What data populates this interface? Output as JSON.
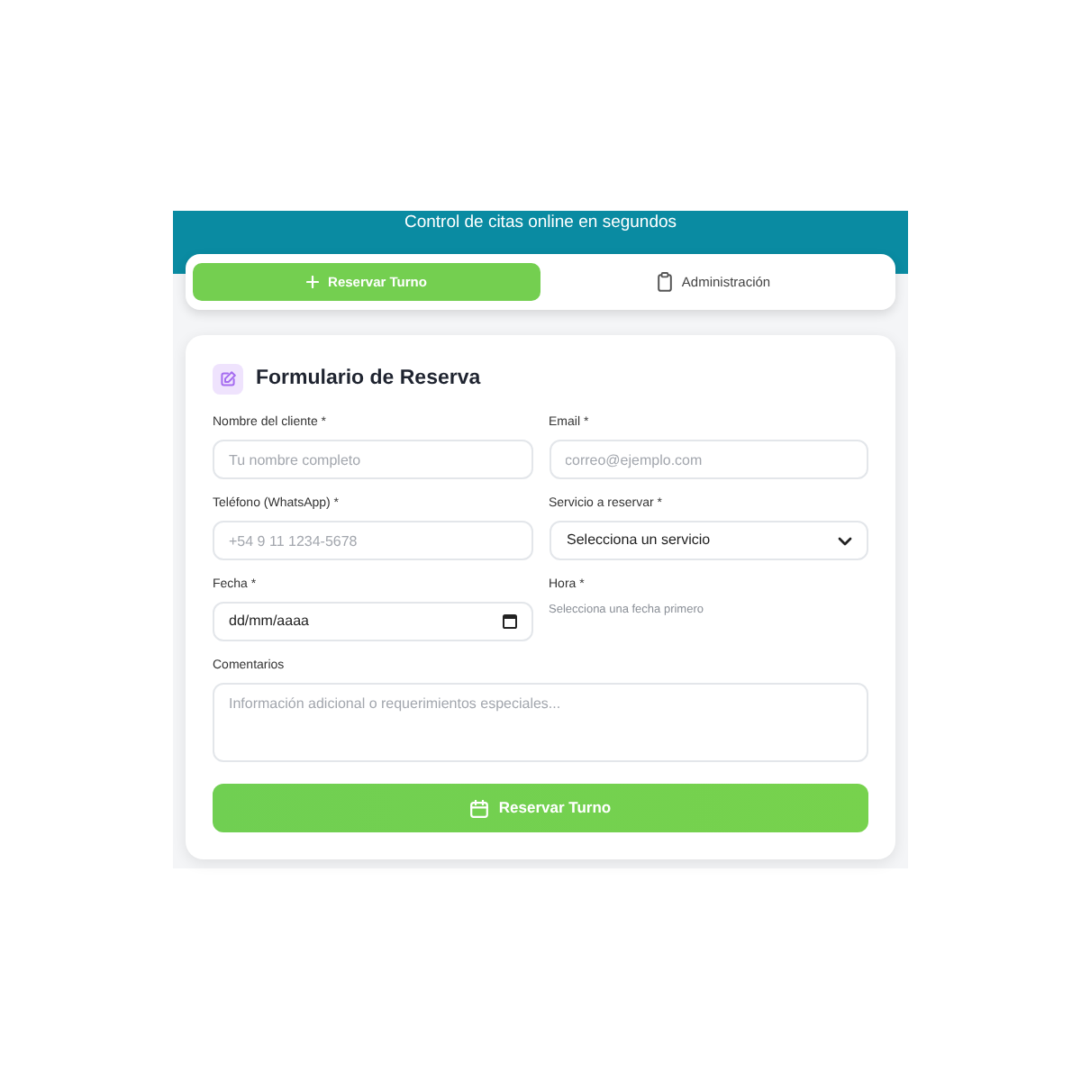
{
  "header": {
    "subtitle": "Control de citas online en segundos"
  },
  "tabs": [
    {
      "label": "Reservar Turno",
      "selected": true
    },
    {
      "label": "Administración",
      "selected": false
    }
  ],
  "form": {
    "title": "Formulario de Reserva",
    "fields": [
      {
        "kind": "input",
        "label": "Nombre del cliente *",
        "placeholder": "Tu nombre completo"
      },
      {
        "kind": "input",
        "label": "Email *",
        "placeholder": "correo@ejemplo.com"
      },
      {
        "kind": "input",
        "label": "Teléfono (WhatsApp) *",
        "placeholder": "+54 9 11 1234-5678"
      },
      {
        "kind": "select",
        "label": "Servicio a reservar *",
        "value": "Selecciona un servicio"
      },
      {
        "kind": "date",
        "label": "Fecha *",
        "value": "dd/mm/aaaa"
      },
      {
        "kind": "note",
        "label": "Hora *",
        "text": "Selecciona una fecha primero"
      },
      {
        "kind": "textarea",
        "label": "Comentarios",
        "placeholder": "Información adicional o requerimientos especiales..."
      }
    ],
    "submit": {
      "label": "Reservar Turno"
    }
  }
}
